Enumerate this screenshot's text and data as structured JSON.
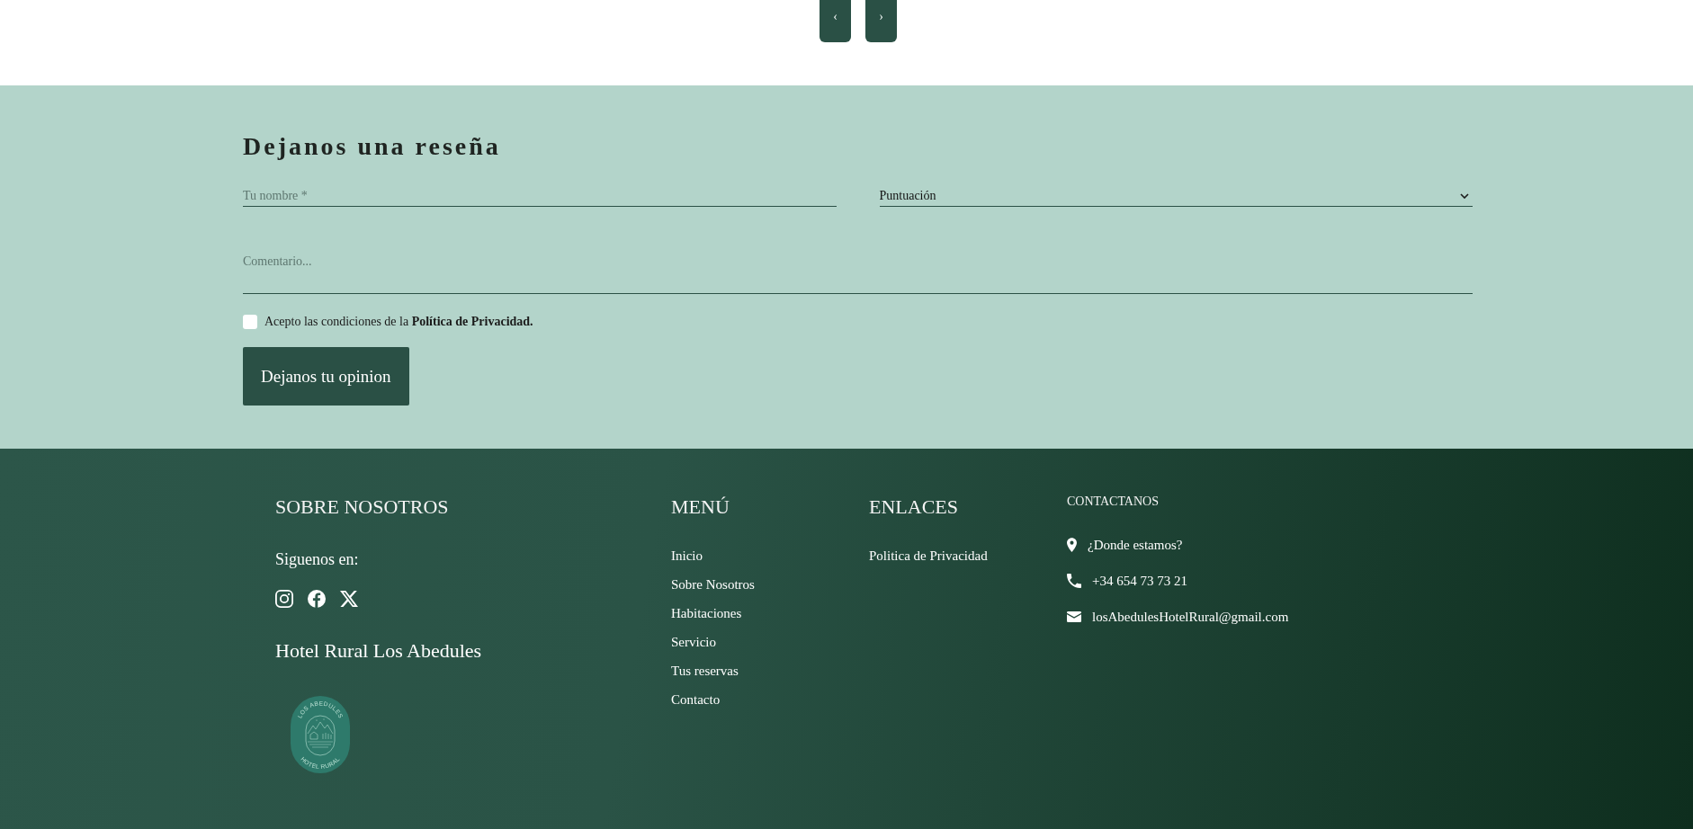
{
  "pager": {
    "buttons": [
      {
        "label": "‹"
      },
      {
        "label": "›"
      }
    ]
  },
  "review_form": {
    "title": "Dejanos una reseña",
    "name_field": {
      "placeholder": "Tu nombre *"
    },
    "rating_select": {
      "value": "Puntuación"
    },
    "comment_field": {
      "placeholder": "Comentario..."
    },
    "consent": {
      "checked": false,
      "label": "Acepto las condiciones de la **Política de Privacidad.**"
    },
    "submit_button": "Dejanos tu opinion"
  },
  "footer": {
    "about": {
      "title": "SOBRE NOSOTROS",
      "follow_label": "Siguenos en:",
      "social_links": [
        {
          "kind": "instagram"
        },
        {
          "kind": "facebook"
        },
        {
          "kind": "x"
        }
      ],
      "hotel_name": "Hotel Rural Los Abedules",
      "logo": {
        "top_text": "LOS ABEDULES",
        "bottom_text": "HOTEL RURAL"
      }
    },
    "menu": {
      "title": "MENÚ",
      "items": [
        "Inicio",
        "Sobre Nosotros",
        "Habitaciones",
        "Servicio",
        "Tus reservas",
        "Contacto"
      ]
    },
    "links": {
      "title": "ENLACES",
      "items": [
        "Politica de Privacidad"
      ]
    },
    "contact": {
      "title": "CONTACTANOS",
      "items": [
        {
          "kind": "location",
          "text": "¿Donde estamos?"
        },
        {
          "kind": "phone",
          "text": "+34 654 73 73 21"
        },
        {
          "kind": "email",
          "text": "losAbedulesHotelRural@gmail.com"
        }
      ]
    }
  }
}
